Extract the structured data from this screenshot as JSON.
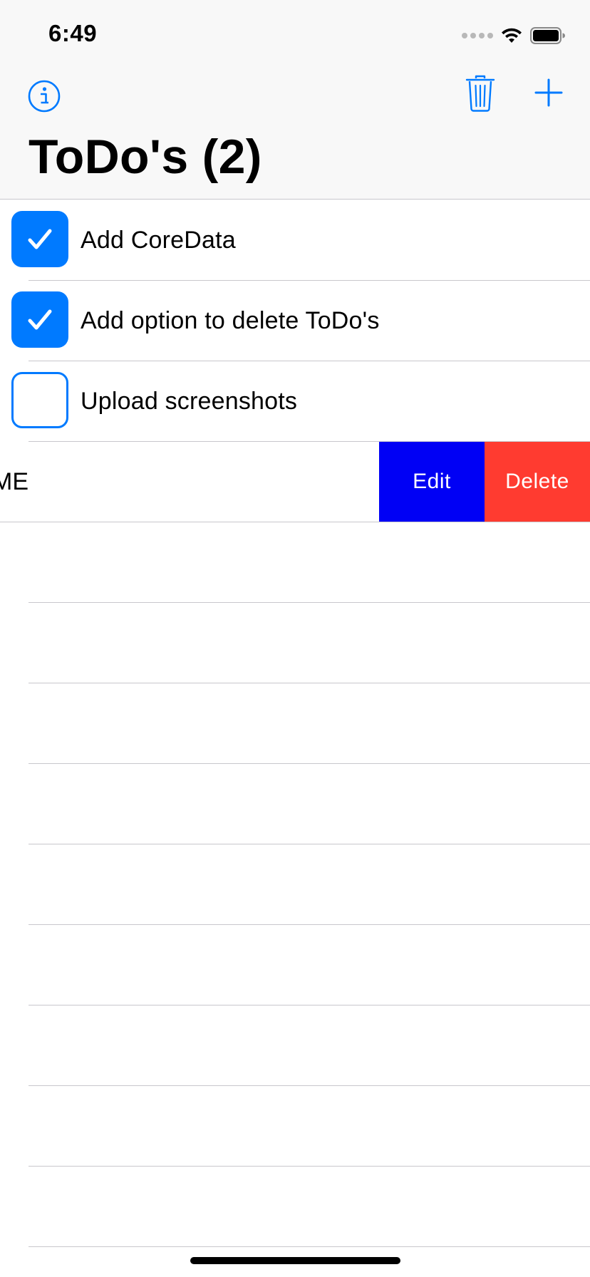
{
  "status_bar": {
    "time": "6:49"
  },
  "nav": {
    "title": "ToDo's (2)",
    "info_icon": "info-circle-icon",
    "trash_icon": "trash-icon",
    "add_icon": "plus-icon",
    "accent_color": "#007aff"
  },
  "todos": [
    {
      "label": "Add CoreData",
      "done": true
    },
    {
      "label": "Add option to delete ToDo's",
      "done": true
    },
    {
      "label": "Upload screenshots",
      "done": false
    }
  ],
  "swiped_row": {
    "visible_text": "ME",
    "edit_label": "Edit",
    "delete_label": "Delete",
    "edit_color": "#0000f5",
    "delete_color": "#ff3b30"
  },
  "empty_row_count": 9
}
